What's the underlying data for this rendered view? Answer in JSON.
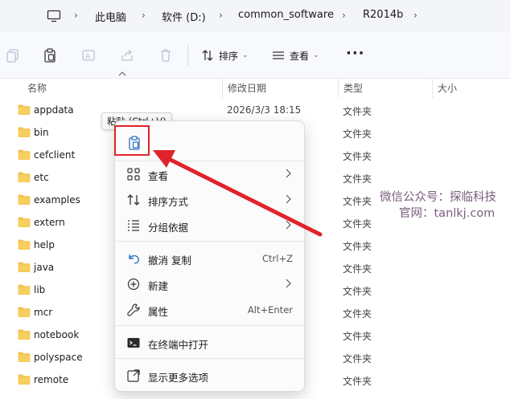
{
  "addressbar": {
    "crumbs": [
      "此电脑",
      "软件 (D:)",
      "common_software",
      "R2014b"
    ],
    "separator": "›"
  },
  "toolbar": {
    "sort_label": "排序",
    "view_label": "查看",
    "more_label": "···"
  },
  "columns": {
    "name": "名称",
    "date": "修改日期",
    "type": "类型",
    "size": "大小"
  },
  "files": [
    {
      "name": "appdata",
      "date": "2026/3/3 18:15",
      "type": "文件夹"
    },
    {
      "name": "bin",
      "date": "",
      "type": "文件夹"
    },
    {
      "name": "cefclient",
      "date": "",
      "type": "文件夹"
    },
    {
      "name": "etc",
      "date": "",
      "type": "文件夹"
    },
    {
      "name": "examples",
      "date": "",
      "type": "文件夹"
    },
    {
      "name": "extern",
      "date": "",
      "type": "文件夹"
    },
    {
      "name": "help",
      "date": "",
      "type": "文件夹"
    },
    {
      "name": "java",
      "date": "",
      "type": "文件夹"
    },
    {
      "name": "lib",
      "date": "",
      "type": "文件夹"
    },
    {
      "name": "mcr",
      "date": "",
      "type": "文件夹"
    },
    {
      "name": "notebook",
      "date": "",
      "type": "文件夹"
    },
    {
      "name": "polyspace",
      "date": "",
      "type": "文件夹"
    },
    {
      "name": "remote",
      "date": "",
      "type": "文件夹"
    }
  ],
  "tooltip": "粘贴 (Ctrl+V)",
  "context_menu": {
    "items": [
      {
        "label": "查看",
        "icon": "grid-icon",
        "submenu": true
      },
      {
        "label": "排序方式",
        "icon": "sort-icon",
        "submenu": true
      },
      {
        "label": "分组依据",
        "icon": "group-icon",
        "submenu": true
      },
      {
        "label": "撤消 复制",
        "icon": "undo-icon",
        "shortcut": "Ctrl+Z"
      },
      {
        "label": "新建",
        "icon": "new-icon",
        "submenu": true
      },
      {
        "label": "属性",
        "icon": "wrench-icon",
        "shortcut": "Alt+Enter"
      },
      {
        "label": "在终端中打开",
        "icon": "terminal-icon"
      },
      {
        "label": "显示更多选项",
        "icon": "more-options-icon"
      }
    ]
  },
  "watermark": {
    "line1": "微信公众号：探临科技",
    "line2": "官网：tanlkj.com"
  },
  "colors": {
    "accent": "#0067c0",
    "folder": "#f2c14e",
    "highlight": "#e0232a"
  }
}
